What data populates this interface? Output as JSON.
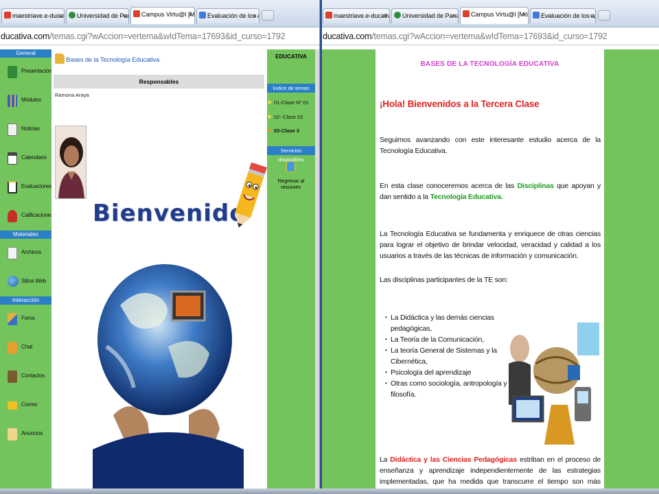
{
  "left_window": {
    "tabs": [
      {
        "title": "maestriave.e-ducativa.com",
        "close": "×",
        "color": "#d9412b"
      },
      {
        "title": "Universidad de Panamá -",
        "close": "×",
        "color": "#2b8f3d"
      },
      {
        "title": "Campus Virtu@l [Módulo",
        "close": "×",
        "color": "#d9412b"
      },
      {
        "title": "Evaluación de los aprendi",
        "close": "×",
        "color": "#3e7bdc"
      }
    ],
    "url_domain": "ducativa.com",
    "url_path": "/temas.cgi?wAccion=vertema&wIdTema=17693&id_curso=1792",
    "sidebar": {
      "general_header": "General",
      "materiales_header": "Materiales",
      "interaccion_header": "Interacción",
      "items": [
        {
          "label": "Presentación",
          "icon": "presentation-icon",
          "color": "#2f8a3a"
        },
        {
          "label": "Módulos",
          "icon": "modules-icon",
          "color": "#3463b8"
        },
        {
          "label": "Noticias",
          "icon": "news-icon",
          "color": "#d9d9d9"
        },
        {
          "label": "Calendario",
          "icon": "calendar-icon",
          "color": "#444444"
        },
        {
          "label": "Evaluaciones",
          "icon": "evaluations-icon",
          "color": "#e8c040"
        },
        {
          "label": "Calificaciones",
          "icon": "grades-icon",
          "color": "#c43025"
        },
        {
          "label": "Archivos",
          "icon": "files-icon",
          "color": "#e0e0e0"
        },
        {
          "label": "Sitios Web",
          "icon": "websites-icon",
          "color": "#2a72c6"
        },
        {
          "label": "Foros",
          "icon": "forums-icon",
          "color": "#e0b040"
        },
        {
          "label": "Chat",
          "icon": "chat-icon",
          "color": "#e3a030"
        },
        {
          "label": "Contactos",
          "icon": "contacts-icon",
          "color": "#7a5a2e"
        },
        {
          "label": "Correo",
          "icon": "mail-icon",
          "color": "#f0c020"
        },
        {
          "label": "Anuncios",
          "icon": "announcements-icon",
          "color": "#eed68a"
        }
      ]
    },
    "content": {
      "course_title": "Bases de la Tecnología Educativa",
      "responsables_header": "Responsables",
      "responsable_name": "Ramona Araya",
      "welcome_text": "Bienvenido"
    },
    "right_bar": {
      "educativa": "EDUCATIVA",
      "index_header": "Índice de temas",
      "topics": [
        "01-Clase Nº 01",
        "02- Clase 02",
        "03-Clase 3"
      ],
      "services_header": "Servicios disponibles",
      "back_link": "Regresar al resumen"
    }
  },
  "right_window": {
    "tabs": [
      {
        "title": "maestriave.e-ducativa.com",
        "close": "×",
        "color": "#d9412b"
      },
      {
        "title": "Universidad de Panamá -",
        "close": "×",
        "color": "#2b8f3d"
      },
      {
        "title": "Campus Virtu@l [Módulo",
        "close": "×",
        "color": "#d9412b"
      },
      {
        "title": "Evaluación de los aprend",
        "close": "×",
        "color": "#3e7bdc"
      }
    ],
    "url_domain": "ducativa.com",
    "url_path": "/temas.cgi?wAccion=vertema&wIdTema=17693&id_curso=1792",
    "article": {
      "title": "BASES   DE   LA TECNOLOGÍA EDUCATIVA",
      "greeting": "¡Hola!  Bienvenidos  a  la Tercera  Clase",
      "p1": "Seguimos avanzando con este interesante  estudio acerca de la Tecnología Educativa.",
      "p2_a": "En esta clase conoceremos acerca de las ",
      "p2_b": "Disciplinas",
      "p2_c": " que apoyan  y dan sentido a la ",
      "p2_d": "Tecnología  Educativa.",
      "p3": " La Tecnología Educativa se fundamenta y enriquece de otras ciencias para lograr el objetivo de brindar velocidad, veracidad y calidad a los usuarios a través de las técnicas de información y comunicación.",
      "p4": "Las disciplinas participantes de la TE son:",
      "disciplines": [
        "La Didáctica y las demás ciencias pedagógicas,",
        "La Teoría de la Comunicación,",
        "La teoría General de Sistemas y la Cibernética,",
        "Psicología del aprendizaje",
        "Otras  como sociología, antropología y filosofía."
      ],
      "p5_a": "La ",
      "p5_b": "Didáctica y las Ciencias Pedagógicas",
      "p5_c": " estriban en el proceso de enseñanza y aprendizaje independientemente de las estrategias implementadas, que ha medida que transcurre el tiempo son más novedosas y eficaces."
    }
  },
  "colors": {
    "sidebar_green": "#74c45e",
    "header_blue": "#2b7fc4",
    "title_magenta": "#d23ad0",
    "accent_red": "#e02020",
    "accent_green": "#1e9a21"
  }
}
